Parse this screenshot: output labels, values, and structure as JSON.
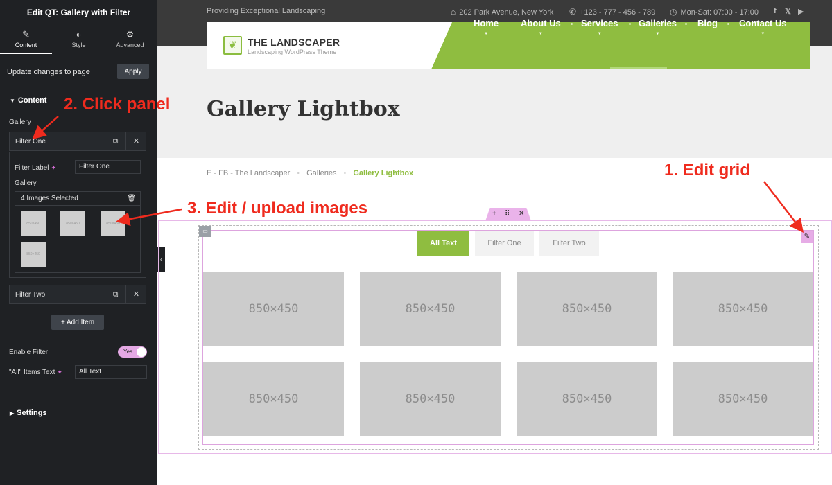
{
  "sidebar": {
    "title": "Edit QT: Gallery with Filter",
    "tabs": [
      {
        "label": "Content",
        "icon": "pencil-icon"
      },
      {
        "label": "Style",
        "icon": "contrast-icon"
      },
      {
        "label": "Advanced",
        "icon": "gear-icon"
      }
    ],
    "update_label": "Update changes to page",
    "apply_label": "Apply",
    "content_section": "Content",
    "gallery_label": "Gallery",
    "filter_one_title": "Filter One",
    "filter_label_label": "Filter Label",
    "filter_label_value": "Filter One",
    "gallery_sub_label": "Gallery",
    "images_selected": "4 Images Selected",
    "thumb_label": "850×450",
    "filter_two_title": "Filter Two",
    "add_item_label": "Add Item",
    "enable_filter_label": "Enable Filter",
    "toggle_label": "Yes",
    "all_items_label": "\"All\" Items Text",
    "all_items_value": "All Text",
    "settings_section": "Settings"
  },
  "topbar": {
    "tagline": "Providing Exceptional Landscaping",
    "address": "202 Park Avenue, New York",
    "phone": "+123 - 777 - 456 - 789",
    "hours": "Mon-Sat: 07:00 - 17:00"
  },
  "header": {
    "logo_name": "THE LANDSCAPER",
    "logo_sub": "Landscaping WordPress Theme",
    "nav": [
      "Home",
      "About Us",
      "Services",
      "Galleries",
      "Blog",
      "Contact Us"
    ]
  },
  "page": {
    "title": "Gallery Lightbox",
    "breadcrumbs": [
      "E - FB - The Landscaper",
      "Galleries",
      "Gallery Lightbox"
    ]
  },
  "gallery": {
    "filters": [
      "All Text",
      "Filter One",
      "Filter Two"
    ],
    "active_filter": "All Text",
    "image_label": "850×450"
  },
  "annotations": {
    "edit_grid": "1. Edit grid",
    "click_panel": "2. Click panel",
    "edit_images": "3. Edit / upload images"
  },
  "colors": {
    "accent_green": "#8fbd40",
    "annotation_red": "#ef2b1e",
    "editor_dark": "#1f2124",
    "handle_pink": "#e6ace6"
  }
}
